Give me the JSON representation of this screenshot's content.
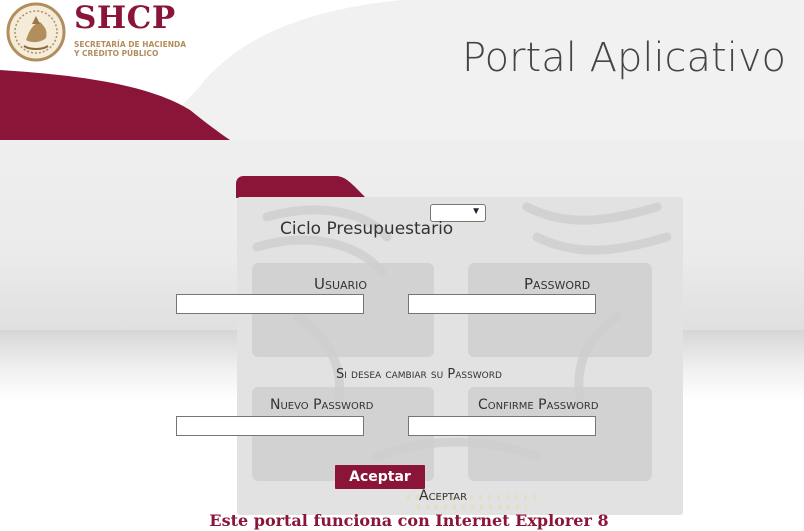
{
  "header": {
    "logo_title": "SHCP",
    "logo_subtitle_line1": "SECRETARÍA DE HACIENDA",
    "logo_subtitle_line2": "Y CRÉDITO PÚBLICO",
    "portal_title": "Portal Aplicativo"
  },
  "form": {
    "ciclo_label": "Ciclo Presupuestario",
    "ciclo_selected": "",
    "usuario_label": "Usuario",
    "usuario_value": "",
    "password_label": "Password",
    "password_value": "",
    "change_password_label": "Si desea cambiar su Password",
    "nuevo_password_label": "Nuevo Password",
    "nuevo_password_value": "",
    "confirme_password_label": "Confirme Password",
    "confirme_password_value": "",
    "submit_label": "Aceptar",
    "submit_caption": "Aceptar"
  },
  "footer": {
    "notice": "Este portal funciona con Internet Explorer 8"
  },
  "colors": {
    "brand": "#8a1538",
    "gold": "#b38e5d",
    "panel": "#e2e2e2"
  },
  "icons": {
    "seal": "mexican-coat-of-arms-icon",
    "dropdown": "chevron-down-icon"
  }
}
